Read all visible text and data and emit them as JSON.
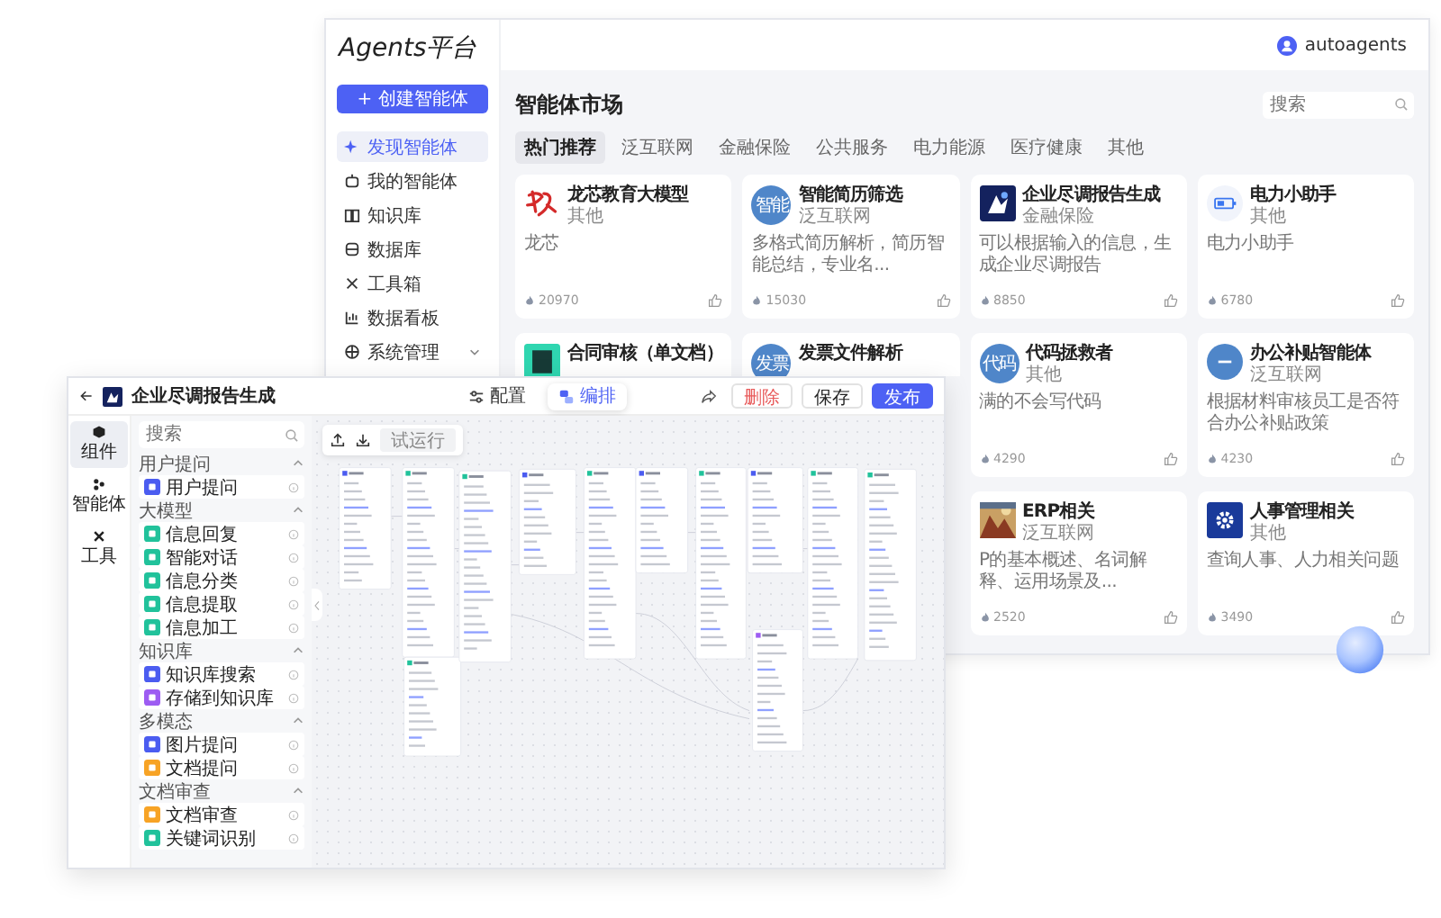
{
  "market": {
    "logo": "Agents平台",
    "user": "autoagents",
    "create_button": "+ 创建智能体",
    "nav": [
      {
        "label": "发现智能体",
        "selected": true,
        "has_children": false
      },
      {
        "label": "我的智能体",
        "selected": false,
        "has_children": false
      },
      {
        "label": "知识库",
        "selected": false,
        "has_children": false
      },
      {
        "label": "数据库",
        "selected": false,
        "has_children": false
      },
      {
        "label": "工具箱",
        "selected": false,
        "has_children": false
      },
      {
        "label": "数据看板",
        "selected": false,
        "has_children": false
      },
      {
        "label": "系统管理",
        "selected": false,
        "has_children": true
      }
    ],
    "title": "智能体市场",
    "search": {
      "placeholder": "搜索"
    },
    "tabs": [
      {
        "label": "热门推荐",
        "selected": true
      },
      {
        "label": "泛互联网",
        "selected": false
      },
      {
        "label": "金融保险",
        "selected": false
      },
      {
        "label": "公共服务",
        "selected": false
      },
      {
        "label": "电力能源",
        "selected": false
      },
      {
        "label": "医疗健康",
        "selected": false
      },
      {
        "label": "其他",
        "selected": false
      }
    ],
    "cards": [
      {
        "kind": "brush",
        "title": "龙芯教育大模型",
        "category": "其他",
        "description": "龙芯",
        "count": "20970"
      },
      {
        "kind": "initials",
        "icon_text": "智能",
        "title": "智能简历筛选",
        "category": "泛互联网",
        "description": "多格式简历解析，简历智能总结，专业名...",
        "count": "15030"
      },
      {
        "kind": "bot",
        "title": "企业尽调报告生成",
        "category": "金融保险",
        "description": "可以根据输入的信息，生成企业尽调报告",
        "count": "8850"
      },
      {
        "kind": "battery",
        "title": "电力小助手",
        "category": "其他",
        "description": "电力小助手",
        "count": "6780"
      },
      {
        "kind": "document",
        "title": "合同审核（单文档）"
      },
      {
        "kind": "initials",
        "icon_text": "发票",
        "title": "发票文件解析"
      },
      {
        "kind": "initials",
        "icon_text": "代码",
        "title": "代码拯救者",
        "category": "其他",
        "description": "满的不会写代码",
        "count": "4290"
      },
      {
        "kind": "minus",
        "title": "办公补贴智能体",
        "category": "泛互联网",
        "description": "根据材料审核员工是否符合办公补贴政策",
        "count": "4230"
      },
      {
        "kind": "picture",
        "title": "ERP相关",
        "category": "泛互联网",
        "description": "P的基本概述、名词解释、运用场景及...",
        "count": "2520"
      },
      {
        "kind": "gear",
        "title": "人事管理相关",
        "category": "其他",
        "description": "查询人事、人力相关问题",
        "count": "3490"
      }
    ]
  },
  "editor": {
    "title": "企业尽调报告生成",
    "mode_tabs": [
      {
        "label": "配置",
        "selected": false
      },
      {
        "label": "编排",
        "selected": true
      }
    ],
    "actions": [
      {
        "label": "删除",
        "kind": "danger"
      },
      {
        "label": "保存",
        "kind": "plain"
      },
      {
        "label": "发布",
        "kind": "primary"
      }
    ],
    "rail": [
      {
        "label": "组件",
        "selected": true
      },
      {
        "label": "智能体",
        "selected": false
      },
      {
        "label": "工具",
        "selected": false
      }
    ],
    "search": {
      "placeholder": "搜索"
    },
    "groups": [
      {
        "label": "用户提问",
        "expanded": true,
        "items": [
          {
            "label": "用户提问",
            "color": "#4b5cf0"
          }
        ]
      },
      {
        "label": "大模型",
        "expanded": true,
        "items": [
          {
            "label": "信息回复",
            "color": "#21c29b"
          },
          {
            "label": "智能对话",
            "color": "#21c29b"
          },
          {
            "label": "信息分类",
            "color": "#21c29b"
          },
          {
            "label": "信息提取",
            "color": "#21c29b"
          },
          {
            "label": "信息加工",
            "color": "#21c29b"
          }
        ]
      },
      {
        "label": "知识库",
        "expanded": true,
        "items": [
          {
            "label": "知识库搜索",
            "color": "#4b5cf0"
          },
          {
            "label": "存储到知识库",
            "color": "#9d5cf2"
          }
        ]
      },
      {
        "label": "多模态",
        "expanded": true,
        "items": [
          {
            "label": "图片提问",
            "color": "#4b5cf0"
          },
          {
            "label": "文档提问",
            "color": "#f7a325"
          }
        ]
      },
      {
        "label": "文档审查",
        "expanded": true,
        "items": [
          {
            "label": "文档审查",
            "color": "#f7a325"
          },
          {
            "label": "关键词识别",
            "color": "#21c29b"
          }
        ]
      }
    ],
    "run_button": "试运行"
  }
}
